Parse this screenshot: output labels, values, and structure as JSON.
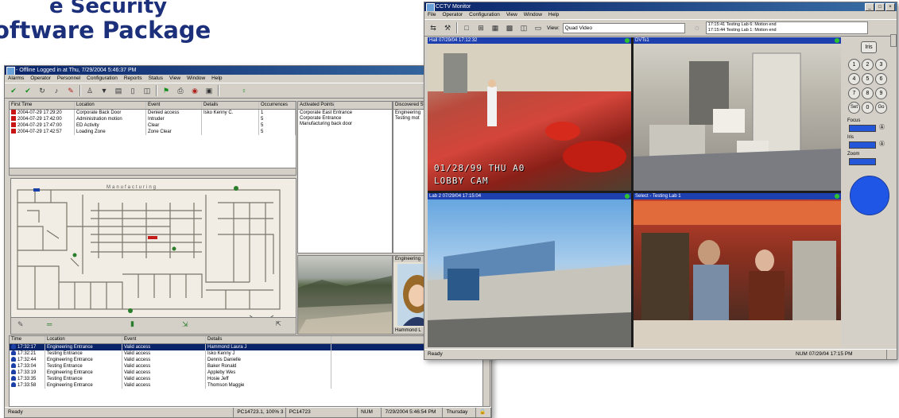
{
  "heading": {
    "line1": "e Security",
    "line2": "oftware Package"
  },
  "left_window": {
    "title": "- Offline Logged in at  Thu, 7/29/2004 5:46:37 PM",
    "menu": [
      "Alarms",
      "Operator",
      "Personnel",
      "Configuration",
      "Reports",
      "Status",
      "View",
      "Window",
      "Help"
    ],
    "alarms": {
      "columns": [
        "First Time",
        "Location",
        "Event",
        "Details",
        "Occurrences"
      ],
      "rows": [
        [
          "2004-07-29 17:29:20",
          "Corporate Back Door",
          "Denied access",
          "Isko Kenny C.",
          "1"
        ],
        [
          "2004-07-29 17:42:00",
          "Administration motion",
          "Intruder",
          "",
          "5"
        ],
        [
          "2004-07-29 17:47:00",
          "ED Activity",
          "Clear",
          "",
          "5"
        ],
        [
          "2004-07-29 17:42:57",
          "Loading Zone",
          "Zone Clear",
          "",
          "5"
        ]
      ]
    },
    "activated_points": {
      "header": "Activated Points",
      "items": [
        "Corporate East Entrance",
        "Corporate Entrance",
        "Manufacturing back door"
      ]
    },
    "discovered": {
      "header": "Discovered Sta",
      "items": [
        "Engineering",
        "Testing mot"
      ]
    },
    "map_label": "Manufacturing",
    "photo_labels": [
      "Engineering",
      "Hammond L"
    ],
    "events": {
      "columns": [
        "Time",
        "Location",
        "Event",
        "Details"
      ],
      "rows": [
        [
          "17:32:17",
          "Engineering Entrance",
          "Valid access",
          "Hammond Laura J"
        ],
        [
          "17:32:21",
          "Testing Entrance",
          "Valid access",
          "Isko Kenny J"
        ],
        [
          "17:32:44",
          "Engineering Entrance",
          "Valid access",
          "Dennis Danielle"
        ],
        [
          "17:33:04",
          "Testing Entrance",
          "Valid access",
          "Baker Ronald"
        ],
        [
          "17:33:19",
          "Engineering Entrance",
          "Valid access",
          "Appleby Wes"
        ],
        [
          "17:33:35",
          "Testing Entrance",
          "Valid access",
          "Hosie Jeff"
        ],
        [
          "17:33:58",
          "Engineering Entrance",
          "Valid access",
          "Thomson Maggie"
        ]
      ]
    },
    "status": {
      "left": "Ready",
      "pc": "PC14723.1, 100% 3 3",
      "pc2": "PC14723",
      "num": "NUM",
      "datetime": "7/29/2004 5:46:54 PM",
      "day": "Thursday"
    }
  },
  "right_window": {
    "title": "CCTV Monitor",
    "menu": [
      "File",
      "Operator",
      "Configuration",
      "View",
      "Window",
      "Help"
    ],
    "view_label": "View:",
    "view_value": "Quad Video",
    "alerts": [
      "17:15:41 Testing Lab 6: Motion end",
      "17:15:44 Testing Lab 1: Motion end"
    ],
    "cams": [
      {
        "label": "Hall 07/29/04 17:12:32",
        "overlay1": "01/28/99   THU A0",
        "overlay2": "LOBBY CAM"
      },
      {
        "label": "DVTs1"
      },
      {
        "label": "Lab 2 07/29/04 17:15:04"
      },
      {
        "label": "Select - Testing Lab 1"
      }
    ],
    "keypad": [
      "1",
      "2",
      "3",
      "4",
      "5",
      "6",
      "7",
      "8",
      "9",
      "Set",
      "0",
      "Go"
    ],
    "keypad_top": "Iris",
    "ptz_labels": [
      "Focus",
      "Iris",
      "Zoom"
    ],
    "status": {
      "left": "Ready",
      "right": "NUM  07/29/04  17:15 PM"
    }
  }
}
